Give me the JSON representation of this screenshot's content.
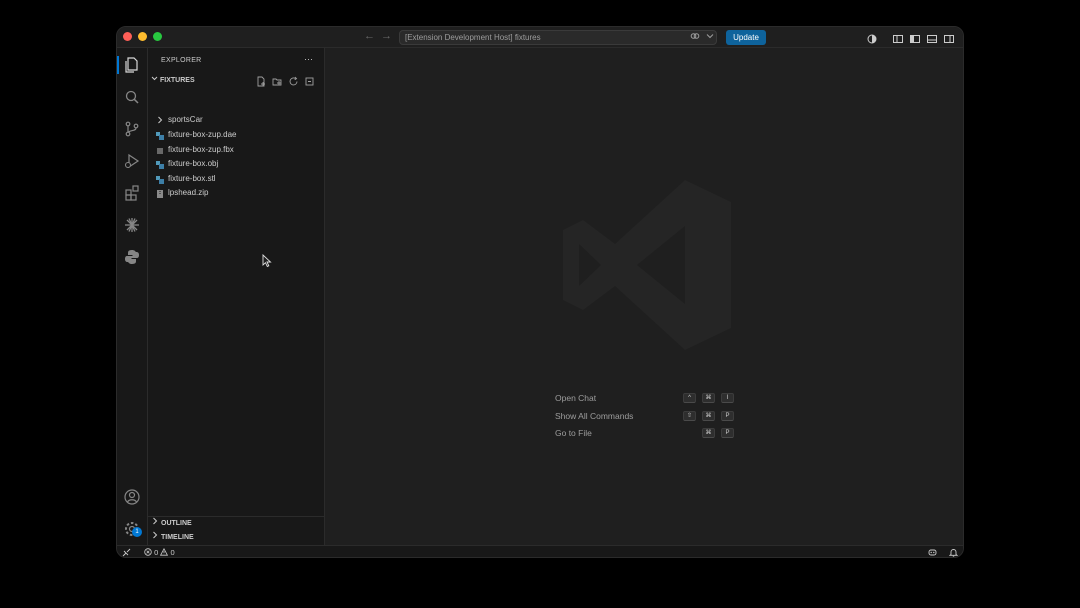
{
  "titlebar": {
    "back_arrow": "←",
    "forward_arrow": "→",
    "command_center": "[Extension Development Host] fixtures",
    "update_label": "Update"
  },
  "activity_bar": {
    "items": [
      "explorer-icon",
      "search-icon",
      "source-control-icon",
      "run-debug-icon",
      "extensions-icon",
      "spark-icon",
      "python-icon"
    ],
    "bottom": [
      "account-icon",
      "settings-gear-icon"
    ],
    "settings_badge": "1"
  },
  "sidebar": {
    "title": "EXPLORER",
    "more": "···",
    "section_title": "FIXTURES",
    "files": [
      {
        "label": "sportsCar",
        "type": "folder"
      },
      {
        "label": "fixture-box-zup.dae",
        "type": "model"
      },
      {
        "label": "fixture-box-zup.fbx",
        "type": "text"
      },
      {
        "label": "fixture-box.obj",
        "type": "model"
      },
      {
        "label": "fixture-box.stl",
        "type": "model"
      },
      {
        "label": "lpshead.zip",
        "type": "zip"
      }
    ],
    "outline": "OUTLINE",
    "timeline": "TIMELINE"
  },
  "editor": {
    "hints": [
      {
        "label": "Open Chat",
        "keys": [
          "^",
          "⌘",
          "I"
        ]
      },
      {
        "label": "Show All Commands",
        "keys": [
          "⇧",
          "⌘",
          "P"
        ]
      },
      {
        "label": "Go to File",
        "keys": [
          "⌘",
          "P"
        ]
      }
    ]
  },
  "statusbar": {
    "errors": "0",
    "warnings": "0"
  },
  "colors": {
    "accent": "#0078d4",
    "update_button": "#0e639c",
    "editor_bg": "#1f1f1f",
    "sidebar_bg": "#181818"
  }
}
